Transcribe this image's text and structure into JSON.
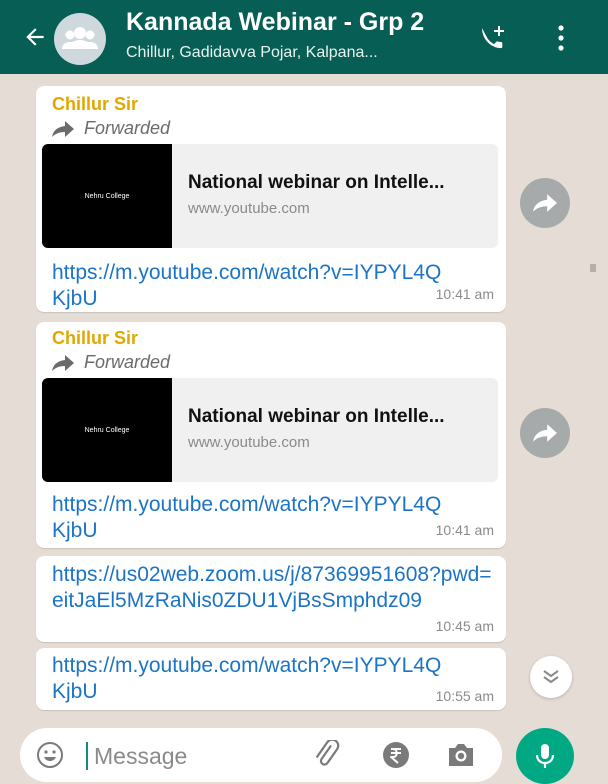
{
  "header": {
    "title": "Kannada Webinar - Grp 2",
    "subtitle": "Chillur, Gadidavva Pojar, Kalpana...",
    "icons": [
      "back-arrow-icon",
      "group-avatar-icon",
      "add-call-icon",
      "more-vert-icon"
    ]
  },
  "messages": [
    {
      "sender": "Chillur Sir",
      "forwarded": "Forwarded",
      "preview_thumb_text": "Nehru College",
      "preview_title": "National webinar on Intelle...",
      "preview_domain": "www.youtube.com",
      "link": "https://m.youtube.com/watch?v=IYPYL4QKjbU",
      "time": "10:41 am"
    },
    {
      "sender": "Chillur Sir",
      "forwarded": "Forwarded",
      "preview_thumb_text": "Nehru College",
      "preview_title": "National webinar on Intelle...",
      "preview_domain": "www.youtube.com",
      "link": "https://m.youtube.com/watch?v=IYPYL4QKjbU",
      "time": "10:41 am"
    },
    {
      "link": "https://us02web.zoom.us/j/87369951608?pwd=eitJaEl5MzRaNis0ZDU1VjBsSmphdz09",
      "time": "10:45 am"
    },
    {
      "link": "https://m.youtube.com/watch?v=IYPYL4QKjbU",
      "time": "10:55 am"
    }
  ],
  "input": {
    "placeholder": "Message"
  },
  "colors": {
    "header": "#075e54",
    "background": "#e5ddd5",
    "sender": "#e0a800",
    "link": "#1b74c5",
    "mic": "#00a884"
  }
}
